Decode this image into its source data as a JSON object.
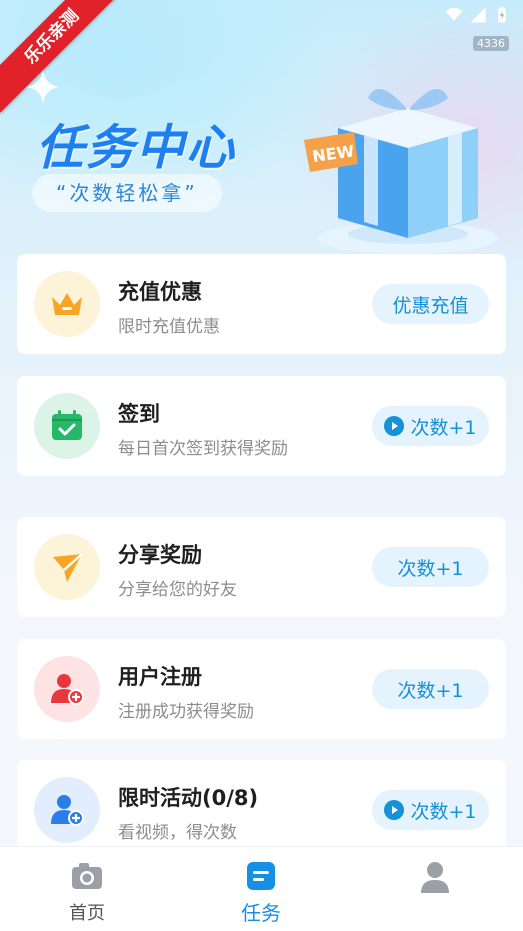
{
  "status_bar": {
    "build_badge": "4336"
  },
  "ribbon": {
    "text": "乐乐亲测"
  },
  "hero": {
    "title": "任务中心",
    "tagline": "“次数轻松拿”",
    "gift_badge": "NEW"
  },
  "tasks": [
    {
      "title": "充值优惠",
      "subtitle": "限时充值优惠",
      "button": "优惠充值",
      "icon": "crown-icon",
      "has_play": false,
      "color": "#f6a623"
    },
    {
      "title": "签到",
      "subtitle": "每日首次签到获得奖励",
      "button": "次数+1",
      "icon": "calendar-check-icon",
      "has_play": true,
      "color": "#25b869"
    },
    {
      "title": "分享奖励",
      "subtitle": "分享给您的好友",
      "button": "次数+1",
      "icon": "send-icon",
      "has_play": false,
      "color": "#f6a623"
    },
    {
      "title": "用户注册",
      "subtitle": "注册成功获得奖励",
      "button": "次数+1",
      "icon": "user-add-icon",
      "has_play": false,
      "color": "#e8383d"
    },
    {
      "title": "限时活动(0/8)",
      "subtitle": "看视频，得次数",
      "button": "次数+1",
      "icon": "user-plus-icon",
      "has_play": true,
      "color": "#2b7de9"
    }
  ],
  "tabbar": {
    "tabs": [
      {
        "label": "首页",
        "icon": "camera-icon",
        "active": false
      },
      {
        "label": "任务",
        "icon": "task-list-icon",
        "active": true
      },
      {
        "label": "",
        "icon": "profile-icon",
        "active": false
      }
    ]
  },
  "colors": {
    "accent": "#1690e6",
    "button_bg": "#e4f3fd"
  }
}
